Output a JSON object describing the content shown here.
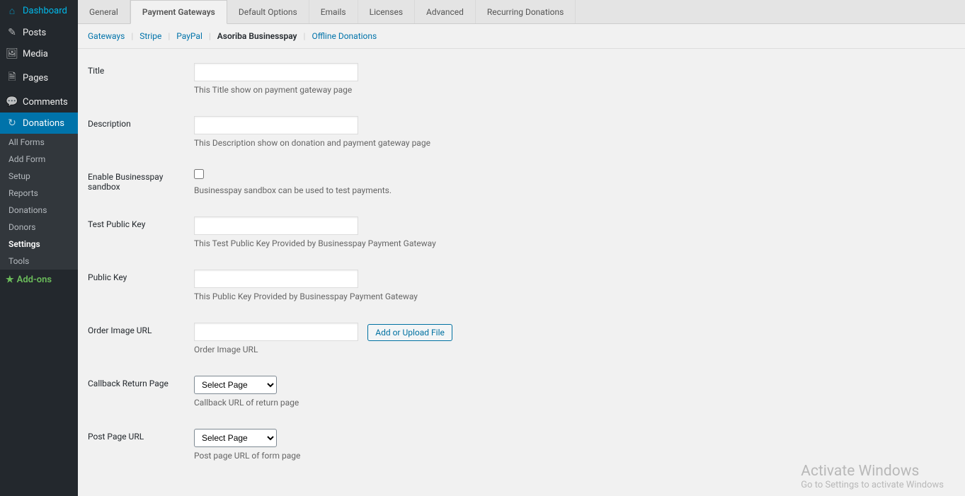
{
  "sidebar": {
    "items": [
      {
        "label": "Dashboard",
        "icon": "⌂"
      },
      {
        "label": "Posts",
        "icon": "✎"
      },
      {
        "label": "Media",
        "icon": "🖼"
      },
      {
        "label": "Pages",
        "icon": "🗎"
      },
      {
        "label": "Comments",
        "icon": "💬"
      },
      {
        "label": "Donations",
        "icon": "↻"
      }
    ],
    "submenu": [
      {
        "label": "All Forms"
      },
      {
        "label": "Add Form"
      },
      {
        "label": "Setup"
      },
      {
        "label": "Reports"
      },
      {
        "label": "Donations"
      },
      {
        "label": "Donors"
      },
      {
        "label": "Settings"
      },
      {
        "label": "Tools"
      }
    ],
    "addons_label": "Add-ons"
  },
  "tabs": [
    {
      "label": "General"
    },
    {
      "label": "Payment Gateways"
    },
    {
      "label": "Default Options"
    },
    {
      "label": "Emails"
    },
    {
      "label": "Licenses"
    },
    {
      "label": "Advanced"
    },
    {
      "label": "Recurring Donations"
    }
  ],
  "subtabs": [
    {
      "label": "Gateways"
    },
    {
      "label": "Stripe"
    },
    {
      "label": "PayPal"
    },
    {
      "label": "Asoriba Businesspay"
    },
    {
      "label": "Offline Donations"
    }
  ],
  "form": {
    "title": {
      "label": "Title",
      "hint": "This Title show on payment gateway page",
      "value": ""
    },
    "description": {
      "label": "Description",
      "hint": "This Description show on donation and payment gateway page",
      "value": ""
    },
    "sandbox": {
      "label": "Enable Businesspay sandbox",
      "hint": "Businesspay sandbox can be used to test payments."
    },
    "test_public_key": {
      "label": "Test Public Key",
      "hint": "This Test Public Key Provided by Businesspay Payment Gateway",
      "value": ""
    },
    "public_key": {
      "label": "Public Key",
      "hint": "This Public Key Provided by Businesspay Payment Gateway",
      "value": ""
    },
    "order_image_url": {
      "label": "Order Image URL",
      "hint": "Order Image URL",
      "value": "",
      "upload_button": "Add or Upload File"
    },
    "callback_return": {
      "label": "Callback Return Page",
      "hint": "Callback URL of return page",
      "option": "Select Page"
    },
    "post_page_url": {
      "label": "Post Page URL",
      "hint": "Post page URL of form page",
      "option": "Select Page"
    }
  },
  "watermark": {
    "line1": "Activate Windows",
    "line2": "Go to Settings to activate Windows"
  }
}
